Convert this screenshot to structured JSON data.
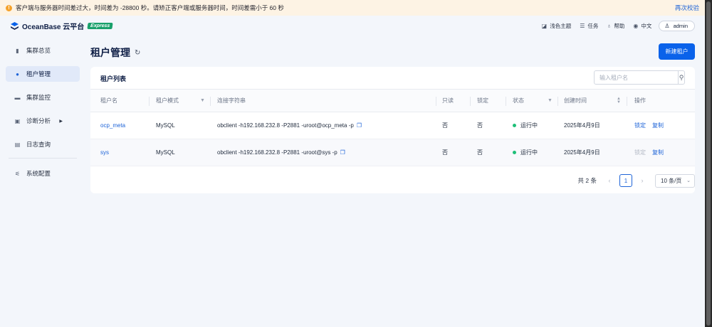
{
  "warning": {
    "text": "客户端与服务器时间差过大，时间差为 -28800 秒。请矫正客户端或服务器时间，时间差需小于 60 秒",
    "action": "再次校验"
  },
  "header": {
    "logo_text": "OceanBase 云平台",
    "badge": "Express",
    "items": [
      {
        "label": "浅色主题",
        "icon": "theme-icon"
      },
      {
        "label": "任务",
        "icon": "list-icon"
      },
      {
        "label": "帮助",
        "icon": "bulb-icon"
      },
      {
        "label": "中文",
        "icon": "globe-icon"
      }
    ],
    "user": "admin"
  },
  "sidebar": {
    "items": [
      {
        "label": "集群总览",
        "icon": "bar-chart-icon"
      },
      {
        "label": "租户管理",
        "icon": "tenant-icon",
        "active": true
      },
      {
        "label": "集群监控",
        "icon": "monitor-icon"
      },
      {
        "label": "诊断分析",
        "icon": "diagnose-icon",
        "expandable": true
      },
      {
        "label": "日志查询",
        "icon": "log-icon"
      },
      {
        "label": "系统配置",
        "icon": "settings-icon"
      }
    ]
  },
  "page": {
    "title": "租户管理",
    "new_button": "新建租户"
  },
  "card": {
    "title": "租户列表",
    "search_placeholder": "输入租户名"
  },
  "table": {
    "columns": [
      "租户名",
      "租户模式",
      "连接字符串",
      "只读",
      "锁定",
      "状态",
      "创建时间",
      "操作"
    ],
    "rows": [
      {
        "name": "ocp_meta",
        "mode": "MySQL",
        "conn": "obclient -h192.168.232.8 -P2881 -uroot@ocp_meta -p",
        "readonly": "否",
        "locked": "否",
        "status": "运行中",
        "created": "2025年4月9日",
        "action_lock": "锁定",
        "action_copy": "复制"
      },
      {
        "name": "sys",
        "mode": "MySQL",
        "conn": "obclient -h192.168.232.8 -P2881 -uroot@sys -p",
        "readonly": "否",
        "locked": "否",
        "status": "运行中",
        "created": "2025年4月9日",
        "action_lock": "锁定",
        "action_copy": "复制"
      }
    ]
  },
  "pagination": {
    "total": "共 2 条",
    "current": "1",
    "page_size": "10 条/页"
  },
  "colors": {
    "primary": "#0a62ea",
    "link": "#1e64d8",
    "status_running": "#1ebf78",
    "warning": "#f5a22b"
  }
}
